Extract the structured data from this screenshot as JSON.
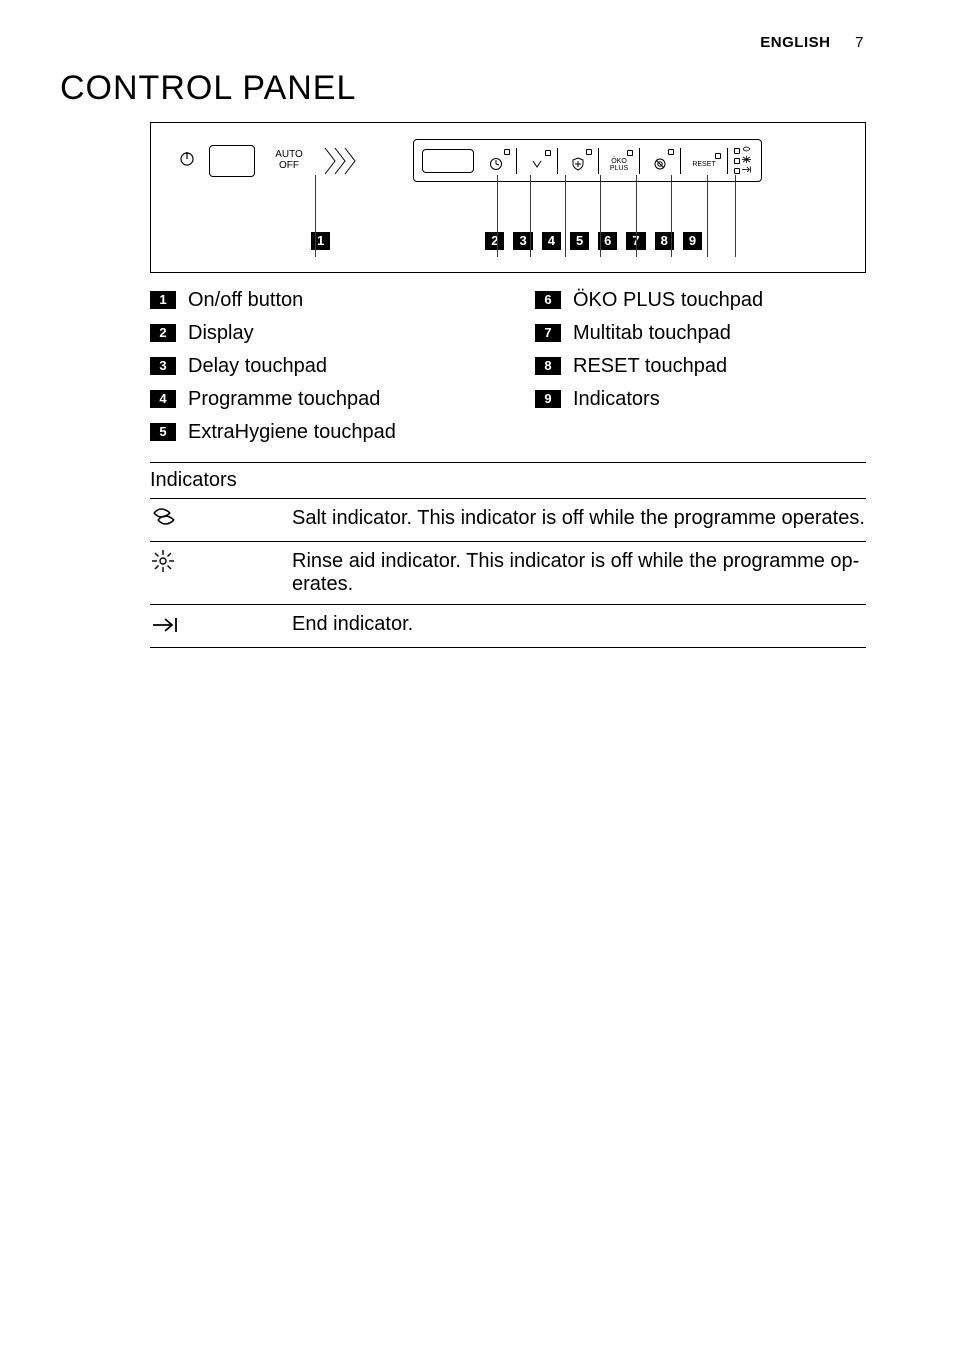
{
  "header": {
    "lang": "ENGLISH",
    "page_number": "7"
  },
  "section_title": "CONTROL PANEL",
  "panel": {
    "auto_line1": "AUTO",
    "auto_line2": "OFF",
    "touchpads": {
      "oko_label": "ÖKO\nPLUS",
      "reset_label": "RESET"
    }
  },
  "callouts": [
    "1",
    "2",
    "3",
    "4",
    "5",
    "6",
    "7",
    "8",
    "9"
  ],
  "legend_left": [
    {
      "n": "1",
      "t": "On/off button"
    },
    {
      "n": "2",
      "t": "Display"
    },
    {
      "n": "3",
      "t": "Delay touchpad"
    },
    {
      "n": "4",
      "t": "Programme touchpad"
    },
    {
      "n": "5",
      "t": "ExtraHygiene touchpad"
    }
  ],
  "legend_right": [
    {
      "n": "6",
      "t": "ÖKO PLUS touchpad"
    },
    {
      "n": "7",
      "t": "Multitab touchpad"
    },
    {
      "n": "8",
      "t": "RESET touchpad"
    },
    {
      "n": "9",
      "t": "Indicators"
    }
  ],
  "indicators_heading": "Indicators",
  "indicators": [
    {
      "icon": "salt",
      "desc": "Salt indicator. This indicator is off while the programme operates."
    },
    {
      "icon": "rinse",
      "desc": "Rinse aid indicator. This indicator is off while the programme op­erates."
    },
    {
      "icon": "end",
      "desc": "End indicator."
    }
  ]
}
